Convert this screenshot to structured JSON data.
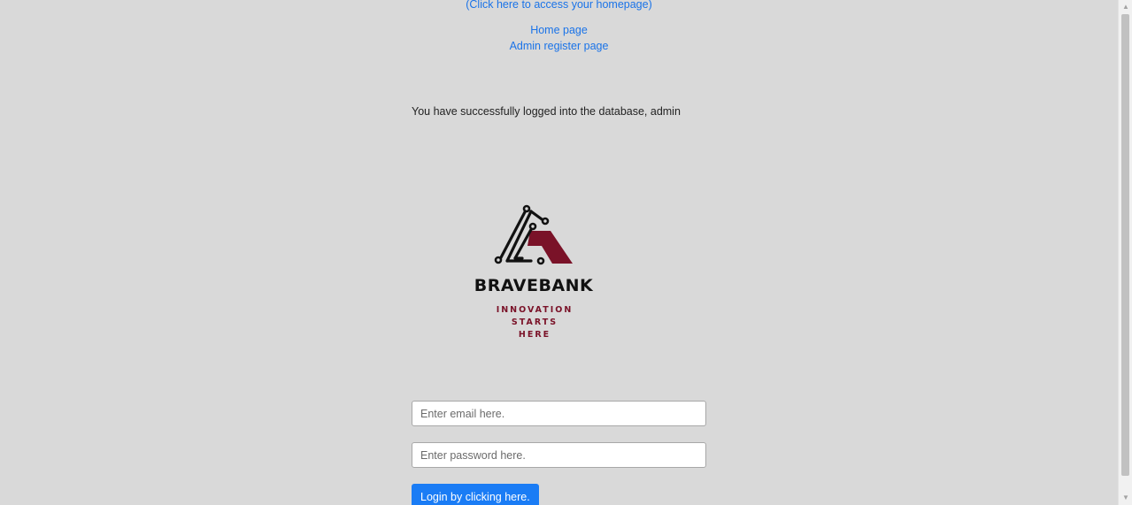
{
  "links": {
    "homepage_access": "(Click here to access your homepage)",
    "home_page": "Home page",
    "admin_register": "Admin register page"
  },
  "status_message": "You have successfully logged into the database, admin",
  "logo": {
    "brand_name": "BRAVEBANK",
    "tagline_line1": "INNOVATION STARTS",
    "tagline_line2": "HERE",
    "icon": "bravebank-logo",
    "colors": {
      "dark": "#111111",
      "accent": "#7a1228"
    }
  },
  "form": {
    "email_placeholder": "Enter email here.",
    "password_placeholder": "Enter password here.",
    "login_button": "Login by clicking here."
  },
  "colors": {
    "background": "#d9d9d9",
    "link": "#1a73e8",
    "button": "#1a7cf5"
  }
}
